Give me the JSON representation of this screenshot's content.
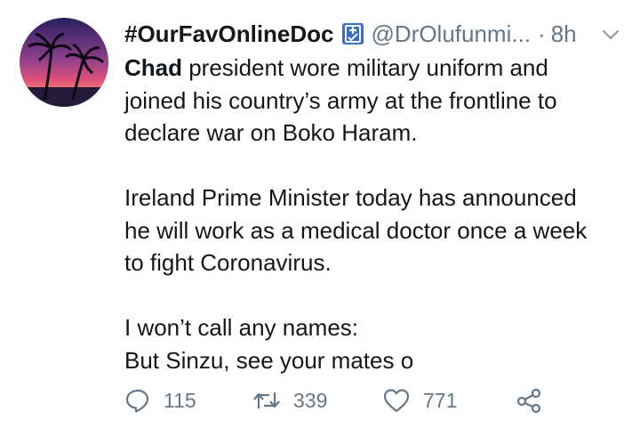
{
  "tweet": {
    "display_name": "#OurFavOnlineDoc",
    "handle": "@DrOlufunmi...",
    "separator": "·",
    "time": "8h",
    "body": {
      "p1_bold": "Chad",
      "p1_line1_rest": " president wore military uniform and",
      "p1_line2": "joined his country’s army at the frontline to",
      "p1_line3": "declare war on Boko Haram.",
      "p2_line1": "Ireland Prime Minister today has announced",
      "p2_line2": "he will work as a medical doctor once a week",
      "p2_line3": "to fight Coronavirus.",
      "p3_line1": "I won’t call any names:",
      "p3_line2": "But Sinzu, see your mates o"
    },
    "actions": {
      "reply_count": "115",
      "retweet_count": "339",
      "like_count": "771"
    }
  },
  "icons": {
    "badge": "medical-badge-icon",
    "chevron": "chevron-down-icon",
    "reply": "reply-icon",
    "retweet": "retweet-icon",
    "like": "heart-icon",
    "share": "share-icon"
  },
  "colors": {
    "text": "#14171a",
    "secondary": "#657786",
    "badge_blue": "#3b6fc4"
  }
}
